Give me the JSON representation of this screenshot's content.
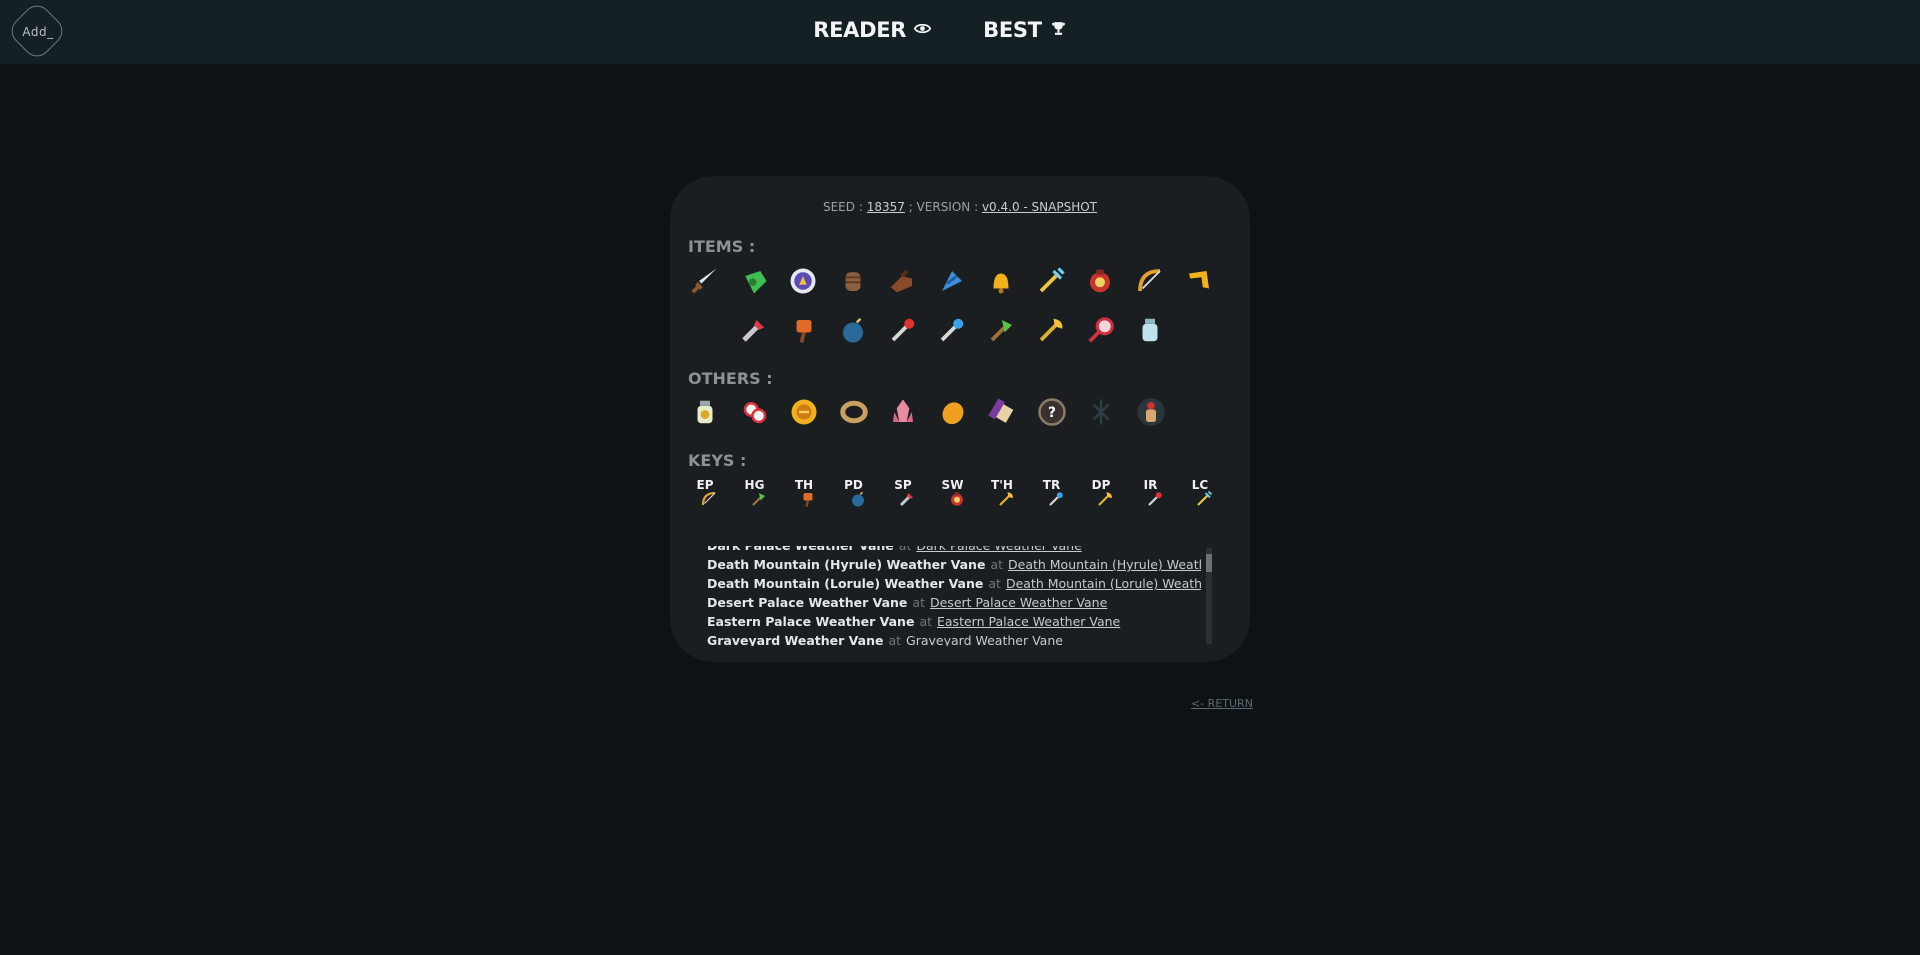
{
  "header": {
    "logo_text": "Add_",
    "nav": [
      {
        "label": "READER",
        "icon": "eye-icon"
      },
      {
        "label": "BEST",
        "icon": "trophy-icon"
      }
    ]
  },
  "card": {
    "seed_prefix": "SEED :",
    "seed_value": "18357",
    "version_prefix": "; VERSION :",
    "version_value": "v0.4.0 - SNAPSHOT",
    "items_title": "ITEMS :",
    "items_row1": [
      "sword-icon",
      "lamp-icon",
      "shield-icon",
      "gauntlet-icon",
      "boots-icon",
      "flippers-icon",
      "bell-icon",
      "ice-rod-icon",
      "bomb-bag-icon",
      "bow-icon",
      "boomerang-icon"
    ],
    "items_row2": [
      "hookshot-icon",
      "hammer-icon",
      "bomb-icon",
      "fire-rod-icon",
      "ice-rod-blue-icon",
      "tornado-rod-icon",
      "sand-rod-icon",
      "net-icon",
      "bottle-icon"
    ],
    "others_title": "OTHERS :",
    "others": [
      "bottle-gold-icon",
      "heart-pieces-icon",
      "badge-icon",
      "bracelet-icon",
      "crystal-icon",
      "egg-icon",
      "scroll-icon",
      "unknown-icon",
      "dark-rune-icon",
      "bomb-bag-dark-icon"
    ],
    "keys_title": "KEYS :",
    "keys": [
      {
        "label": "EP",
        "icon": "bow-icon"
      },
      {
        "label": "HG",
        "icon": "tornado-rod-icon"
      },
      {
        "label": "TH",
        "icon": "hammer-icon"
      },
      {
        "label": "PD",
        "icon": "bomb-icon"
      },
      {
        "label": "SP",
        "icon": "hookshot-icon"
      },
      {
        "label": "SW",
        "icon": "bomb-bag-icon"
      },
      {
        "label": "T'H",
        "icon": "sand-rod-icon"
      },
      {
        "label": "TR",
        "icon": "ice-rod-blue-icon"
      },
      {
        "label": "DP",
        "icon": "sand-rod-icon"
      },
      {
        "label": "IR",
        "icon": "fire-rod-icon"
      },
      {
        "label": "LC",
        "icon": "ice-rod-icon"
      }
    ],
    "log": [
      {
        "name": "Dark Palace Weather Vane",
        "at": "at",
        "loc": "Dark Palace Weather Vane"
      },
      {
        "name": "Death Mountain (Hyrule) Weather Vane",
        "at": "at",
        "loc": "Death Mountain (Hyrule) Weather Vane"
      },
      {
        "name": "Death Mountain (Lorule) Weather Vane",
        "at": "at",
        "loc": "Death Mountain (Lorule) Weather Vane"
      },
      {
        "name": "Desert Palace Weather Vane",
        "at": "at",
        "loc": "Desert Palace Weather Vane"
      },
      {
        "name": "Eastern Palace Weather Vane",
        "at": "at",
        "loc": "Eastern Palace Weather Vane"
      },
      {
        "name": "Graveyard Weather Vane",
        "at": "at",
        "loc": "Graveyard Weather Vane"
      }
    ]
  },
  "footer": {
    "return_label": "<- RETURN"
  }
}
